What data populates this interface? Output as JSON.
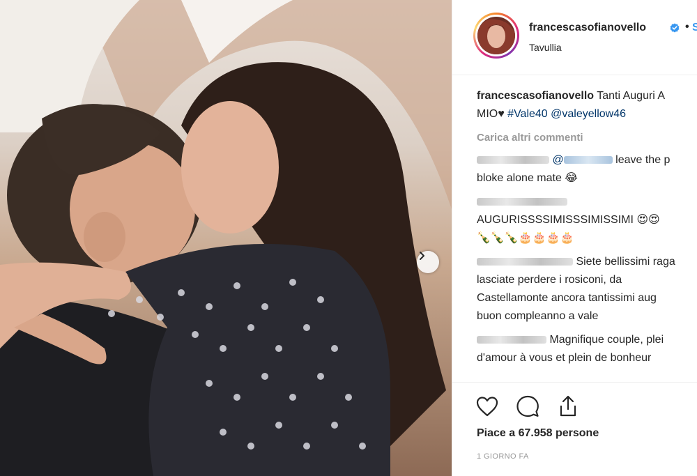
{
  "post": {
    "username": "francescasofianovello",
    "location": "Tavullia",
    "follow_label": "S",
    "separator": "•"
  },
  "caption": {
    "username": "francescasofianovello",
    "text_line1": "Tanti Auguri A",
    "text_line2": "MIO♥",
    "hashtag": "#Vale40",
    "mention": "@valeyellow46"
  },
  "load_more_label": "Carica altri commenti",
  "comments": [
    {
      "mention": "@",
      "line1": "leave the p",
      "line2": "bloke alone mate 😂"
    },
    {
      "line1": "AUGURISSSSIMISSSIMISSIMI 😍😍",
      "line2": "🍾🍾🍾🎂🎂🎂🎂"
    },
    {
      "line1": "Siete bellissimi raga",
      "line2": "lasciate perdere i rosiconi, da",
      "line3": "Castellamonte ancora tantissimi aug",
      "line4": "buon compleanno a vale"
    },
    {
      "line1": "Magnifique couple, plei",
      "line2": "d'amour à vous et plein de bonheur"
    }
  ],
  "icons": {
    "like": "heart-icon",
    "comment": "comment-icon",
    "share": "share-icon",
    "next": "chevron-right-icon",
    "verified": "verified-badge-icon"
  },
  "likes_text": "Piace a 67.958 persone",
  "timestamp": "1 GIORNO FA",
  "colors": {
    "link": "#003569",
    "verified": "#3897f0",
    "muted": "#999999",
    "text": "#262626"
  }
}
